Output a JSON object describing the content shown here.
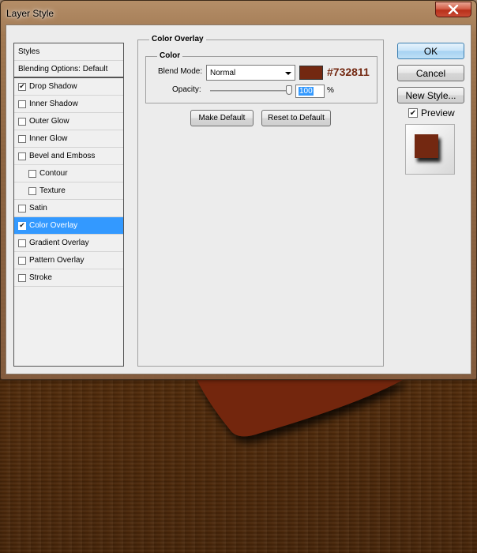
{
  "window": {
    "title": "Layer Style"
  },
  "styles_list": {
    "header": "Styles",
    "blending": "Blending Options: Default",
    "items": [
      {
        "label": "Drop Shadow",
        "checked": true,
        "indent": false,
        "selected": false
      },
      {
        "label": "Inner Shadow",
        "checked": false,
        "indent": false,
        "selected": false
      },
      {
        "label": "Outer Glow",
        "checked": false,
        "indent": false,
        "selected": false
      },
      {
        "label": "Inner Glow",
        "checked": false,
        "indent": false,
        "selected": false
      },
      {
        "label": "Bevel and Emboss",
        "checked": false,
        "indent": false,
        "selected": false
      },
      {
        "label": "Contour",
        "checked": false,
        "indent": true,
        "selected": false
      },
      {
        "label": "Texture",
        "checked": false,
        "indent": true,
        "selected": false
      },
      {
        "label": "Satin",
        "checked": false,
        "indent": false,
        "selected": false
      },
      {
        "label": "Color Overlay",
        "checked": true,
        "indent": false,
        "selected": true
      },
      {
        "label": "Gradient Overlay",
        "checked": false,
        "indent": false,
        "selected": false
      },
      {
        "label": "Pattern Overlay",
        "checked": false,
        "indent": false,
        "selected": false
      },
      {
        "label": "Stroke",
        "checked": false,
        "indent": false,
        "selected": false
      }
    ]
  },
  "panel": {
    "title": "Color Overlay",
    "group_title": "Color",
    "blend_mode_label": "Blend Mode:",
    "blend_mode_value": "Normal",
    "color_hex": "#732811",
    "color_label": "#732811",
    "opacity_label": "Opacity:",
    "opacity_value": "100",
    "opacity_unit": "%",
    "opacity_fraction": 1.0,
    "make_default": "Make Default",
    "reset_default": "Reset to Default"
  },
  "actions": {
    "ok": "OK",
    "cancel": "Cancel",
    "new_style": "New Style...",
    "preview_label": "Preview",
    "preview_checked": true
  },
  "colors": {
    "overlay": "#732811",
    "selection": "#3399ff",
    "envelope": "#732811"
  },
  "icons": {
    "close": "close-icon",
    "dropdown": "chevron-down-icon",
    "checkbox": "checkmark-icon"
  }
}
